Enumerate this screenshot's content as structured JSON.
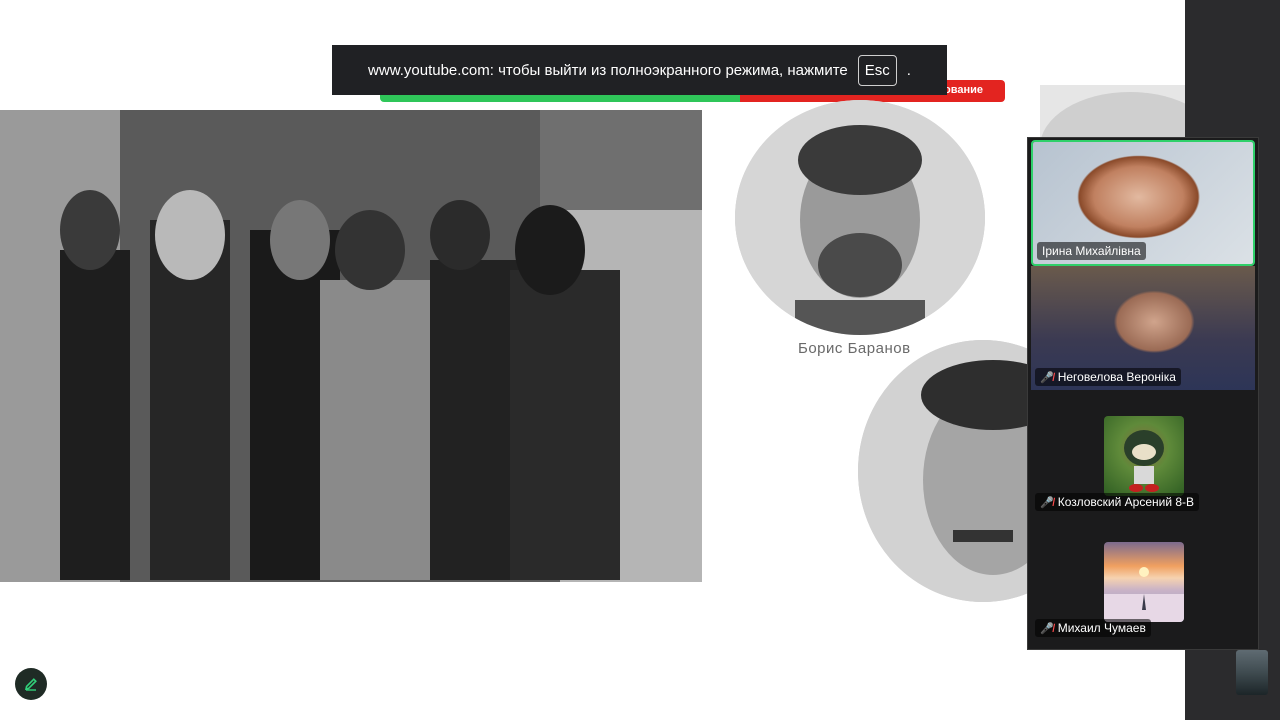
{
  "notice": {
    "text_before": "www.youtube.com: чтобы выйти из полноэкранного режима, нажмите",
    "key": "Esc",
    "text_after": "."
  },
  "slide": {
    "strip_text": "ование",
    "portrait_caption": "Борис Баранов"
  },
  "participants": [
    {
      "name": "Ірина Михайлівна",
      "muted": false,
      "active": true
    },
    {
      "name": "Неговелова Вероніка",
      "muted": true
    },
    {
      "name": "Козловский Арсений 8-В",
      "muted": true
    },
    {
      "name": "Михаил Чумаев",
      "muted": true
    }
  ],
  "icons": {
    "mic_off": "mic-off-icon",
    "edit": "pencil-icon"
  },
  "colors": {
    "active_border": "#2fd06a",
    "strip_green": "#2fc659",
    "strip_red": "#e32420",
    "panel_bg": "#1b1b1c"
  }
}
